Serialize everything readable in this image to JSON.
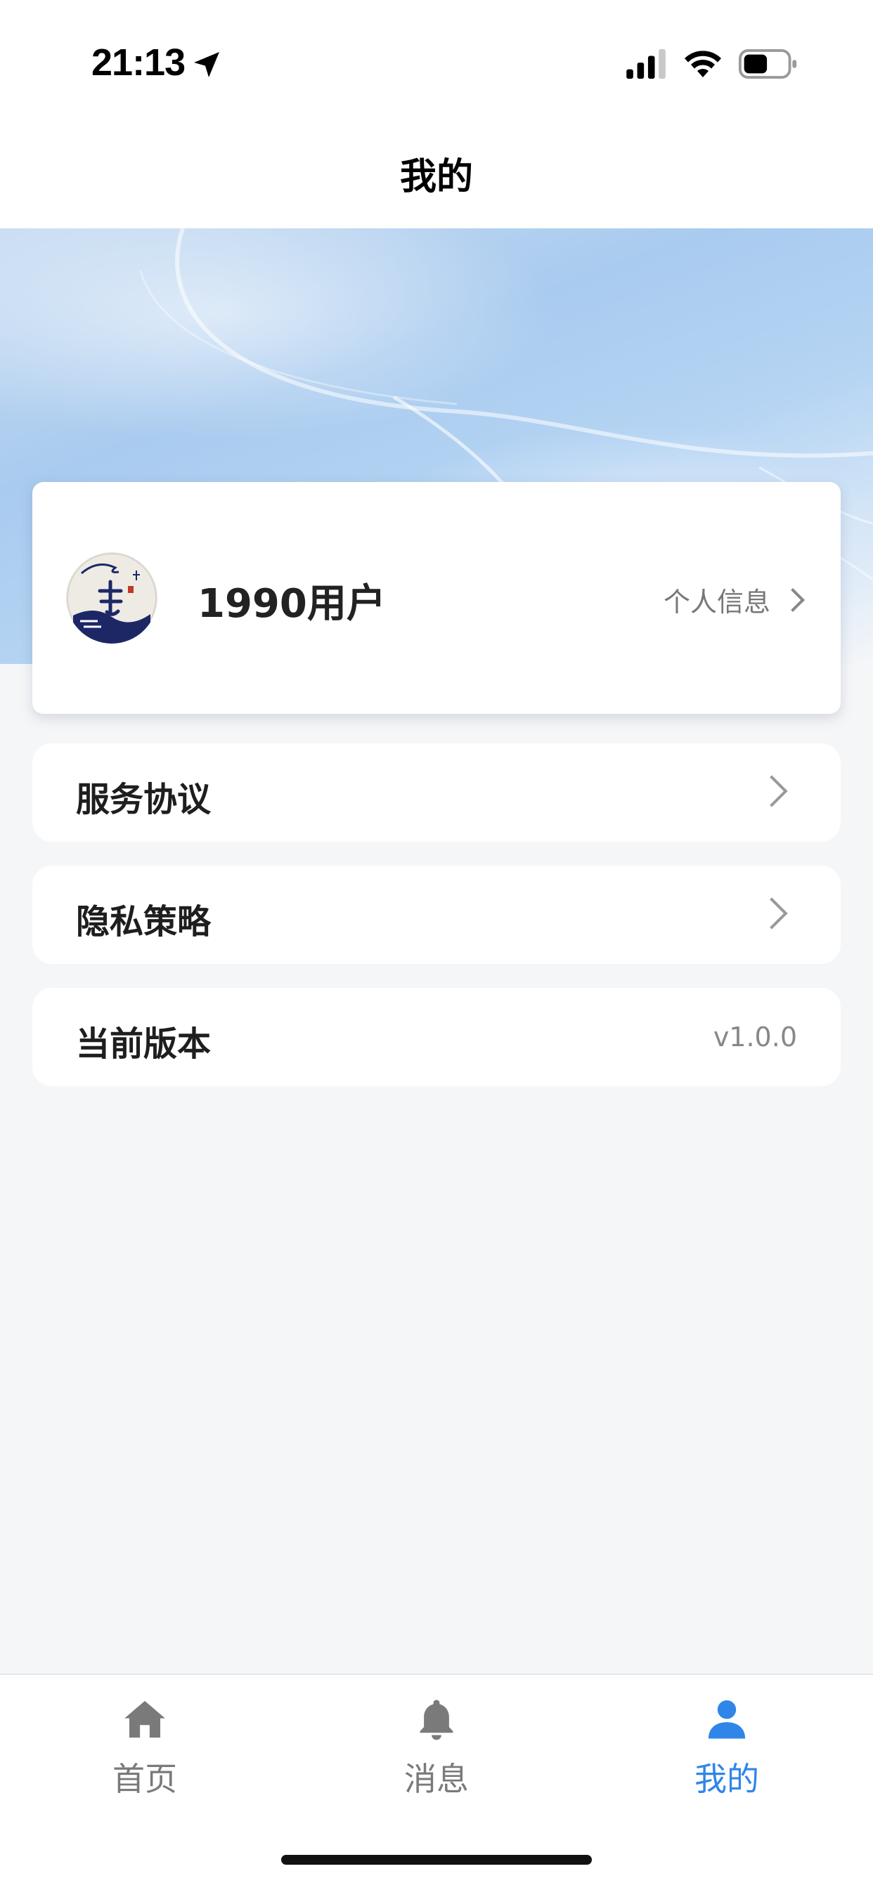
{
  "status_bar": {
    "time": "21:13"
  },
  "header": {
    "title": "我的"
  },
  "profile": {
    "username": "1990用户",
    "link_label": "个人信息"
  },
  "menu": {
    "items": [
      {
        "label": "服务协议"
      },
      {
        "label": "隐私策略"
      },
      {
        "label": "当前版本",
        "value": "v1.0.0"
      }
    ]
  },
  "tab_bar": {
    "tabs": [
      {
        "label": "首页",
        "icon": "home-icon"
      },
      {
        "label": "消息",
        "icon": "bell-icon"
      },
      {
        "label": "我的",
        "icon": "user-icon"
      }
    ],
    "active_index": 2
  },
  "colors": {
    "accent": "#2f86e8",
    "inactive": "#7a7a7a",
    "page_background": "#f5f6f8"
  }
}
